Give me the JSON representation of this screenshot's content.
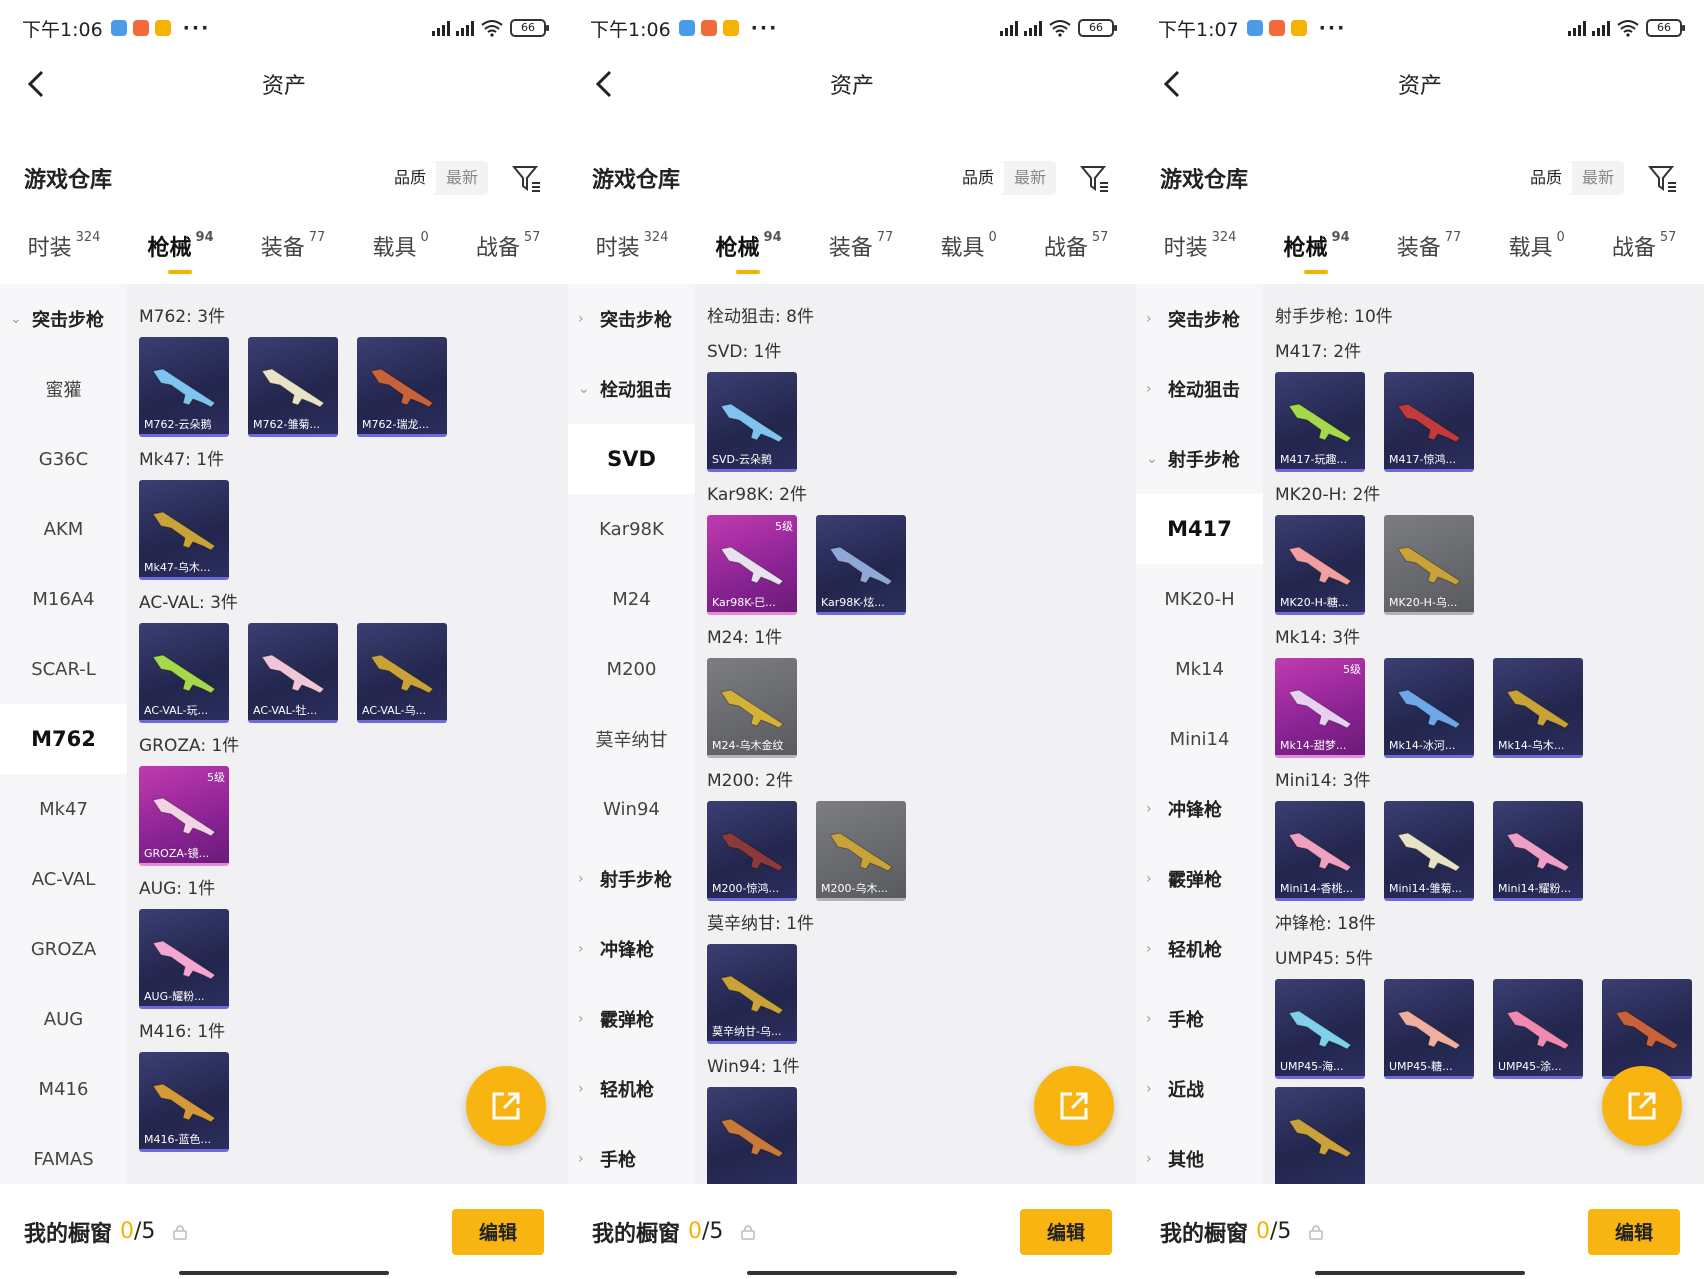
{
  "colors": {
    "accent": "#f8b411",
    "card_blue": "#2c2f5e",
    "card_purple": "#a02da0",
    "card_gray": "#6a6c70"
  },
  "panels": [
    {
      "status": {
        "time": "下午1:06",
        "battery": "66"
      },
      "nav_title": "资产",
      "section_title": "游戏仓库",
      "sort": [
        "品质",
        "最新"
      ],
      "tabs": [
        {
          "label": "时装",
          "count": "324"
        },
        {
          "label": "枪械",
          "count": "94",
          "active": true
        },
        {
          "label": "装备",
          "count": "77"
        },
        {
          "label": "载具",
          "count": "0"
        },
        {
          "label": "战备",
          "count": "57"
        }
      ],
      "sidebar": [
        {
          "label": "突击步枪",
          "type": "group",
          "open": true
        },
        {
          "label": "蜜獾"
        },
        {
          "label": "G36C"
        },
        {
          "label": "AKM"
        },
        {
          "label": "M16A4"
        },
        {
          "label": "SCAR-L"
        },
        {
          "label": "M762",
          "selected": true
        },
        {
          "label": "Mk47"
        },
        {
          "label": "AC-VAL"
        },
        {
          "label": "GROZA"
        },
        {
          "label": "AUG"
        },
        {
          "label": "M416"
        },
        {
          "label": "FAMAS"
        }
      ],
      "categories": [
        {
          "title": "M762: 3件",
          "items": [
            {
              "name": "M762-云朵鹅",
              "style": "blue",
              "gun": "#7fc4ef"
            },
            {
              "name": "M762-雏菊...",
              "style": "blue",
              "gun": "#e8e2c6"
            },
            {
              "name": "M762-瑞龙...",
              "style": "blue",
              "gun": "#c8623a"
            }
          ]
        },
        {
          "title": "Mk47: 1件",
          "items": [
            {
              "name": "Mk47-乌木...",
              "style": "blue",
              "gun": "#c9a33a"
            }
          ]
        },
        {
          "title": "AC-VAL: 3件",
          "items": [
            {
              "name": "AC-VAL-玩...",
              "style": "blue",
              "gun": "#a5d84a"
            },
            {
              "name": "AC-VAL-牡...",
              "style": "blue",
              "gun": "#f0c6d6"
            },
            {
              "name": "AC-VAL-乌...",
              "style": "blue",
              "gun": "#c9a33a"
            }
          ]
        },
        {
          "title": "GROZA: 1件",
          "items": [
            {
              "name": "GROZA-镜...",
              "style": "purple",
              "gun": "#f3d2e6",
              "level": "5级"
            }
          ]
        },
        {
          "title": "AUG: 1件",
          "items": [
            {
              "name": "AUG-耀粉...",
              "style": "blue",
              "gun": "#f3a6d0"
            }
          ]
        },
        {
          "title": "M416: 1件",
          "items": [
            {
              "name": "M416-蓝色...",
              "style": "blue",
              "gun": "#d49a3a"
            }
          ]
        }
      ],
      "bottom": {
        "label": "我的橱窗",
        "count_num": "0",
        "count_rest": "/5",
        "edit": "编辑"
      }
    },
    {
      "status": {
        "time": "下午1:06",
        "battery": "66"
      },
      "nav_title": "资产",
      "section_title": "游戏仓库",
      "sort": [
        "品质",
        "最新"
      ],
      "tabs": [
        {
          "label": "时装",
          "count": "324"
        },
        {
          "label": "枪械",
          "count": "94",
          "active": true
        },
        {
          "label": "装备",
          "count": "77"
        },
        {
          "label": "载具",
          "count": "0"
        },
        {
          "label": "战备",
          "count": "57"
        }
      ],
      "sidebar": [
        {
          "label": "突击步枪",
          "type": "group"
        },
        {
          "label": "栓动狙击",
          "type": "group",
          "open": true
        },
        {
          "label": "SVD",
          "selected": true
        },
        {
          "label": "Kar98K"
        },
        {
          "label": "M24"
        },
        {
          "label": "M200"
        },
        {
          "label": "莫辛纳甘"
        },
        {
          "label": "Win94"
        },
        {
          "label": "射手步枪",
          "type": "group"
        },
        {
          "label": "冲锋枪",
          "type": "group"
        },
        {
          "label": "霰弹枪",
          "type": "group"
        },
        {
          "label": "轻机枪",
          "type": "group"
        },
        {
          "label": "手枪",
          "type": "group"
        }
      ],
      "categories": [
        {
          "title": "栓动狙击: 8件",
          "items": []
        },
        {
          "title": "SVD: 1件",
          "items": [
            {
              "name": "SVD-云朵鹅",
              "style": "blue",
              "gun": "#7fc4ef"
            }
          ]
        },
        {
          "title": "Kar98K: 2件",
          "items": [
            {
              "name": "Kar98K-巳...",
              "style": "purple",
              "gun": "#e8e2f0",
              "level": "5级"
            },
            {
              "name": "Kar98K-炫...",
              "style": "blue",
              "gun": "#8fa8d8"
            }
          ]
        },
        {
          "title": "M24: 1件",
          "items": [
            {
              "name": "M24-乌木金纹",
              "style": "gray",
              "gun": "#d4b23a"
            }
          ]
        },
        {
          "title": "M200: 2件",
          "items": [
            {
              "name": "M200-惊鸿...",
              "style": "blue",
              "gun": "#8a3a3a"
            },
            {
              "name": "M200-乌木...",
              "style": "gray",
              "gun": "#c9a33a"
            }
          ]
        },
        {
          "title": "莫辛纳甘: 1件",
          "items": [
            {
              "name": "莫辛纳甘-乌...",
              "style": "blue",
              "gun": "#c9a33a"
            }
          ]
        },
        {
          "title": "Win94: 1件",
          "items": [
            {
              "name": "",
              "style": "blue",
              "gun": "#c97a3a"
            }
          ]
        }
      ],
      "bottom": {
        "label": "我的橱窗",
        "count_num": "0",
        "count_rest": "/5",
        "edit": "编辑"
      }
    },
    {
      "status": {
        "time": "下午1:07",
        "battery": "66"
      },
      "nav_title": "资产",
      "section_title": "游戏仓库",
      "sort": [
        "品质",
        "最新"
      ],
      "tabs": [
        {
          "label": "时装",
          "count": "324"
        },
        {
          "label": "枪械",
          "count": "94",
          "active": true
        },
        {
          "label": "装备",
          "count": "77"
        },
        {
          "label": "载具",
          "count": "0"
        },
        {
          "label": "战备",
          "count": "57"
        }
      ],
      "sidebar": [
        {
          "label": "突击步枪",
          "type": "group"
        },
        {
          "label": "栓动狙击",
          "type": "group"
        },
        {
          "label": "射手步枪",
          "type": "group",
          "open": true
        },
        {
          "label": "M417",
          "selected": true
        },
        {
          "label": "MK20-H"
        },
        {
          "label": "Mk14"
        },
        {
          "label": "Mini14"
        },
        {
          "label": "冲锋枪",
          "type": "group"
        },
        {
          "label": "霰弹枪",
          "type": "group"
        },
        {
          "label": "轻机枪",
          "type": "group"
        },
        {
          "label": "手枪",
          "type": "group"
        },
        {
          "label": "近战",
          "type": "group"
        },
        {
          "label": "其他",
          "type": "group"
        }
      ],
      "categories": [
        {
          "title": "射手步枪: 10件",
          "items": []
        },
        {
          "title": "M417: 2件",
          "items": [
            {
              "name": "M417-玩趣...",
              "style": "blue",
              "gun": "#a5d84a"
            },
            {
              "name": "M417-惊鸿...",
              "style": "blue",
              "gun": "#c23a3a"
            }
          ]
        },
        {
          "title": "MK20-H: 2件",
          "items": [
            {
              "name": "MK20-H-糖...",
              "style": "blue",
              "gun": "#f0a0a0"
            },
            {
              "name": "MK20-H-乌...",
              "style": "gray",
              "gun": "#c9a33a"
            }
          ]
        },
        {
          "title": "Mk14: 3件",
          "items": [
            {
              "name": "Mk14-甜梦...",
              "style": "purple",
              "gun": "#e8d0f0",
              "level": "5级"
            },
            {
              "name": "Mk14-冰河...",
              "style": "blue",
              "gun": "#6fa8e8"
            },
            {
              "name": "Mk14-乌木...",
              "style": "blue",
              "gun": "#c9a33a"
            }
          ]
        },
        {
          "title": "Mini14: 3件",
          "items": [
            {
              "name": "Mini14-香桃...",
              "style": "blue",
              "gun": "#f0a0c0"
            },
            {
              "name": "Mini14-雏菊...",
              "style": "blue",
              "gun": "#e8e2c6"
            },
            {
              "name": "Mini14-耀粉...",
              "style": "blue",
              "gun": "#f0a0c8"
            }
          ]
        },
        {
          "title": "冲锋枪: 18件",
          "items": []
        },
        {
          "title": "UMP45: 5件",
          "items": [
            {
              "name": "UMP45-海...",
              "style": "blue",
              "gun": "#7fd0e8"
            },
            {
              "name": "UMP45-糖...",
              "style": "blue",
              "gun": "#f0b0a0"
            },
            {
              "name": "UMP45-涂...",
              "style": "blue",
              "gun": "#f08ab0"
            },
            {
              "name": "",
              "style": "blue",
              "gun": "#c9623a"
            }
          ]
        },
        {
          "title": "",
          "items": [
            {
              "name": "",
              "style": "blue",
              "gun": "#c9a33a"
            }
          ]
        }
      ],
      "bottom": {
        "label": "我的橱窗",
        "count_num": "0",
        "count_rest": "/5",
        "edit": "编辑"
      }
    }
  ]
}
